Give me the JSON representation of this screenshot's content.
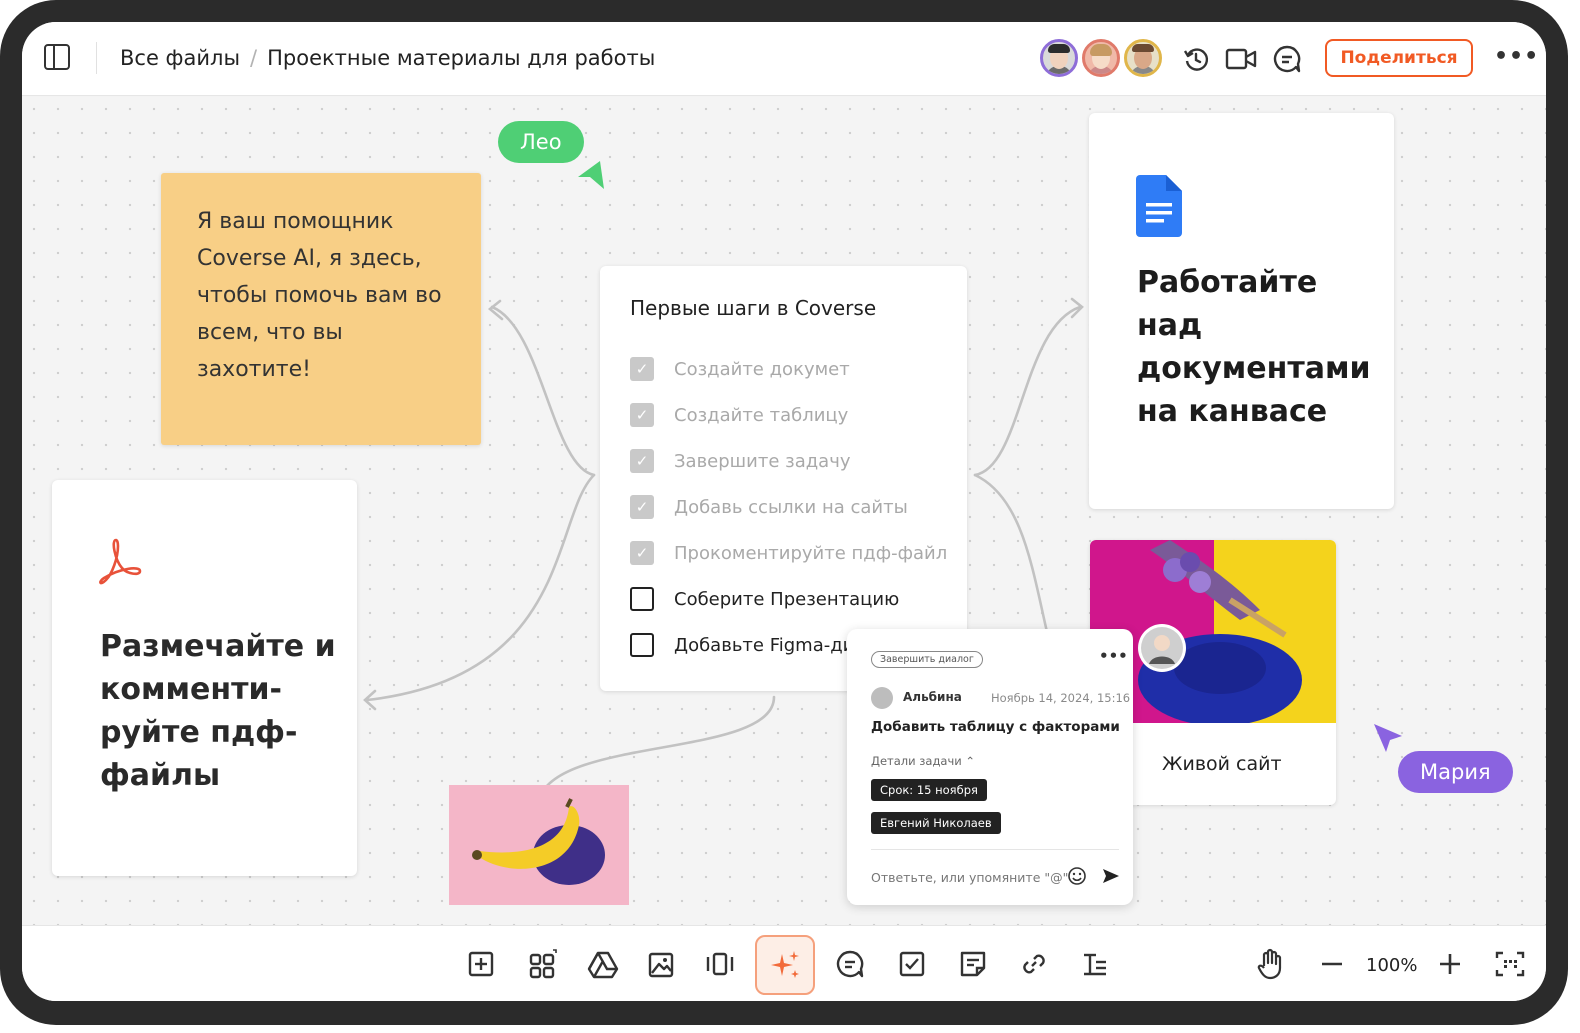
{
  "header": {
    "breadcrumb": [
      "Все файлы",
      "Проектные материалы для работы"
    ],
    "share_label": "Поделиться",
    "more_label": "•••",
    "icons": [
      "sidebar-toggle-icon",
      "history-icon",
      "video-icon",
      "comments-icon"
    ]
  },
  "collaborators": [
    "avatar-man-1",
    "avatar-woman-1",
    "avatar-man-2"
  ],
  "canvas": {
    "sticky_note": "Я ваш помощник Coverse AI, я здесь, чтобы помочь вам во всем, что вы захотите!",
    "checklist": {
      "title": "Первые шаги в Coverse",
      "items": [
        {
          "label": "Создайте докумет",
          "done": true
        },
        {
          "label": "Создайте таблицу",
          "done": true
        },
        {
          "label": "Завершите задачу",
          "done": true
        },
        {
          "label": "Добавь ссылки на сайты",
          "done": true
        },
        {
          "label": "Прокоментируйте пдф-файл",
          "done": true
        },
        {
          "label": "Соберите Презентацию",
          "done": false
        },
        {
          "label": "Добавьте Figma-дизайн",
          "done": false
        }
      ]
    },
    "pdf_card": {
      "text": "Размечайте и комменти-руйте пдф-файлы"
    },
    "doc_card": {
      "text": "Работайте над документами на канвасе"
    },
    "site_card": {
      "label": "Живой сайт"
    },
    "cursors": {
      "leo": "Лео",
      "maria": "Мария"
    },
    "colors": {
      "leo": "#4fcf75",
      "maria": "#8a63e0",
      "accent": "#f15a24",
      "sticky": "#f8cf86"
    }
  },
  "comment": {
    "close_chip": "Завершить диалог",
    "more": "•••",
    "author": "Альбина",
    "date": "Ноябрь 14, 2024, 15:16",
    "body": "Добавить таблицу с факторами",
    "details_label": "Детали задачи",
    "deadline": "Срок: 15 ноября",
    "assignee": "Евгений Николаев",
    "reply_placeholder": "Ответьте, или упомяните \"@\""
  },
  "toolbar": {
    "zoom": "100%",
    "icons": [
      "add-frame-icon",
      "apps-icon",
      "google-drive-icon",
      "image-icon",
      "presentation-icon",
      "ai-sparkle-icon",
      "comment-icon",
      "checkbox-icon",
      "sticky-note-icon",
      "link-icon",
      "text-icon",
      "hand-icon",
      "zoom-out-icon",
      "zoom-in-icon",
      "fit-screen-icon"
    ]
  }
}
